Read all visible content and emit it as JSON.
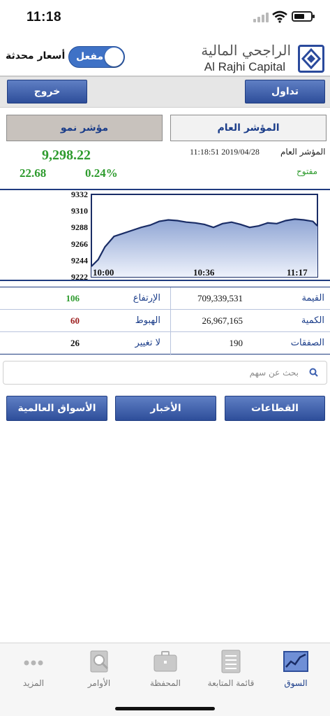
{
  "status_bar": {
    "time": "11:18"
  },
  "header": {
    "brand_ar": "الراجحي المالية",
    "brand_en": "Al Rajhi Capital",
    "live_prices_label": "أسعار محدثة",
    "toggle_label": "مفعل"
  },
  "toolbar": {
    "exit_label": "خروج",
    "trade_label": "تداول"
  },
  "index_tabs": {
    "growth": "مؤشر نمو",
    "general": "المؤشر العام"
  },
  "index": {
    "name": "المؤشر العام",
    "datetime": "11:18:51 2019/04/28",
    "price": "9,298.22",
    "change": "22.68",
    "percent": "0.24%",
    "status": "مفتوح"
  },
  "chart_data": {
    "type": "line",
    "x_ticks": [
      "10:00",
      "10:36",
      "11:17"
    ],
    "y_ticks": [
      9332,
      9310,
      9288,
      9266,
      9244,
      9222
    ],
    "ylim": [
      9222,
      9332
    ],
    "series": [
      {
        "x": [
          0,
          3,
          6,
          10,
          14,
          18,
          22,
          26,
          30,
          34,
          38,
          42,
          46,
          50,
          54,
          58,
          62,
          66,
          70,
          74,
          78,
          82,
          86,
          90,
          94,
          98,
          100
        ],
        "values": [
          9236,
          9245,
          9262,
          9276,
          9280,
          9284,
          9288,
          9291,
          9296,
          9298,
          9297,
          9295,
          9294,
          9292,
          9288,
          9293,
          9295,
          9292,
          9288,
          9290,
          9294,
          9293,
          9297,
          9299,
          9298,
          9296,
          9290
        ]
      }
    ],
    "colors": {
      "line": "#1a2d66",
      "fill": "#b7c5e2"
    }
  },
  "stats": {
    "value_label": "القيمة",
    "value": "709,339,531",
    "volume_label": "الكمية",
    "volume": "26,967,165",
    "trades_label": "الصفقات",
    "trades": "190",
    "up_label": "الإرتفاع",
    "up": "106",
    "down_label": "الهبوط",
    "down": "60",
    "unchanged_label": "لا تغيير",
    "unchanged": "26"
  },
  "search": {
    "placeholder": "بحث عن سهم"
  },
  "nav_buttons": {
    "sectors": "القطاعات",
    "news": "الأخبار",
    "global": "الأسواق العالمية"
  },
  "tabbar": {
    "items": [
      {
        "label": "السوق",
        "icon": "market-chart-icon",
        "active": true
      },
      {
        "label": "قائمة المتابعة",
        "icon": "watchlist-icon",
        "active": false
      },
      {
        "label": "المحفظة",
        "icon": "briefcase-icon",
        "active": false
      },
      {
        "label": "الأوامر",
        "icon": "orders-icon",
        "active": false
      },
      {
        "label": "المزيد",
        "icon": "more-dots-icon",
        "active": false
      }
    ]
  },
  "colors": {
    "accent": "#2e4e9a",
    "up": "#2e9b2e",
    "down": "#9b1c1c"
  }
}
